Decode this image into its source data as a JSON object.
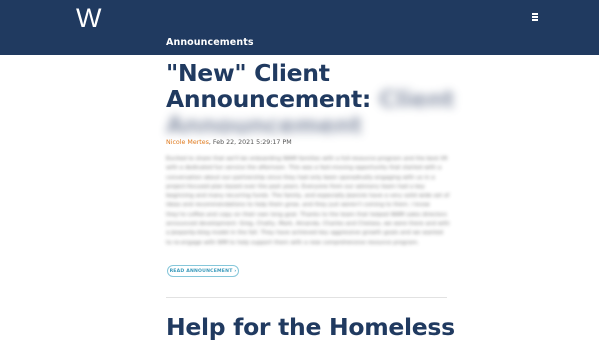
{
  "header": {
    "logo_text": "W",
    "menu_icon": "hamburger-menu-icon",
    "section_label": "Announcements",
    "background_color": "#203a60"
  },
  "article": {
    "title_line1": "\"New\" Client",
    "title_line2": "Announcement:",
    "title_blurred_1": "Client",
    "title_blurred_2": "Announcement",
    "author": "Nicole Mertes",
    "date": ", Feb 22, 2021 5:29:17 PM",
    "body": "Excited to share that we'll be onboarding WAM families with a full-resource program and the best lift with a dedicated fun service the afternoon. This was a fast-moving opportunity that started with a conversation about our partnership since they had only been sporadically engaging with us in a project-focused plan based over the past years. Everyone from our advisory team had a key beginning and many recurring funds. The family, and especially Jeannie have a very solid wide set of ideas and recommendations to help them grow, and they just weren't coming to them. I know they're coffee and copy on their own long goal. Thanks to the team that helped WAM sales directors announced development: Greg, Chatty, Mark, Amanda, Charles and Chelsea, we were there and with a Jeopardy-blog model in the fall. They have achieved key aggressive growth goals and we wanted to re-engage with WM to help support them with a new comprehensive resource program.",
    "read_button": "READ ANNOUNCEMENT ›",
    "author_color": "#e07b1f"
  },
  "next_article": {
    "title": "Help for the Homeless"
  }
}
